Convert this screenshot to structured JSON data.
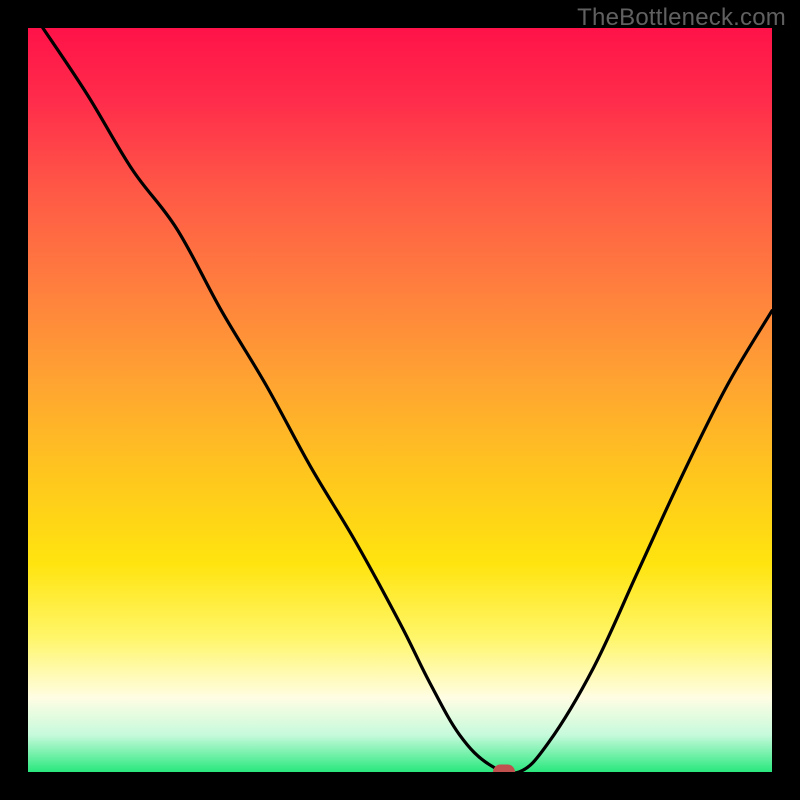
{
  "watermark": "TheBottleneck.com",
  "colors": {
    "frame_bg": "#000000",
    "curve_stroke": "#000000",
    "marker_fill": "#c0504d",
    "gradient_top": "#ff1249",
    "gradient_bottom": "#29e87d"
  },
  "chart_data": {
    "type": "line",
    "title": "",
    "xlabel": "",
    "ylabel": "",
    "xlim": [
      0,
      100
    ],
    "ylim": [
      0,
      100
    ],
    "grid": false,
    "x": [
      2,
      8,
      14,
      20,
      26,
      32,
      38,
      44,
      50,
      54,
      58,
      62,
      66,
      70,
      76,
      82,
      88,
      94,
      100
    ],
    "values": [
      100,
      91,
      81,
      73,
      62,
      52,
      41,
      31,
      20,
      12,
      5,
      1,
      0,
      4,
      14,
      27,
      40,
      52,
      62
    ],
    "marker": {
      "x": 64,
      "y": 0
    },
    "notes": "y is bottleneck percentage (0 = bottom green band, 100 = top red). Curve drops steeply from upper-left, flattens near x≈60-66 at y≈0, then rises toward the right ending near y≈62 at x=100."
  }
}
